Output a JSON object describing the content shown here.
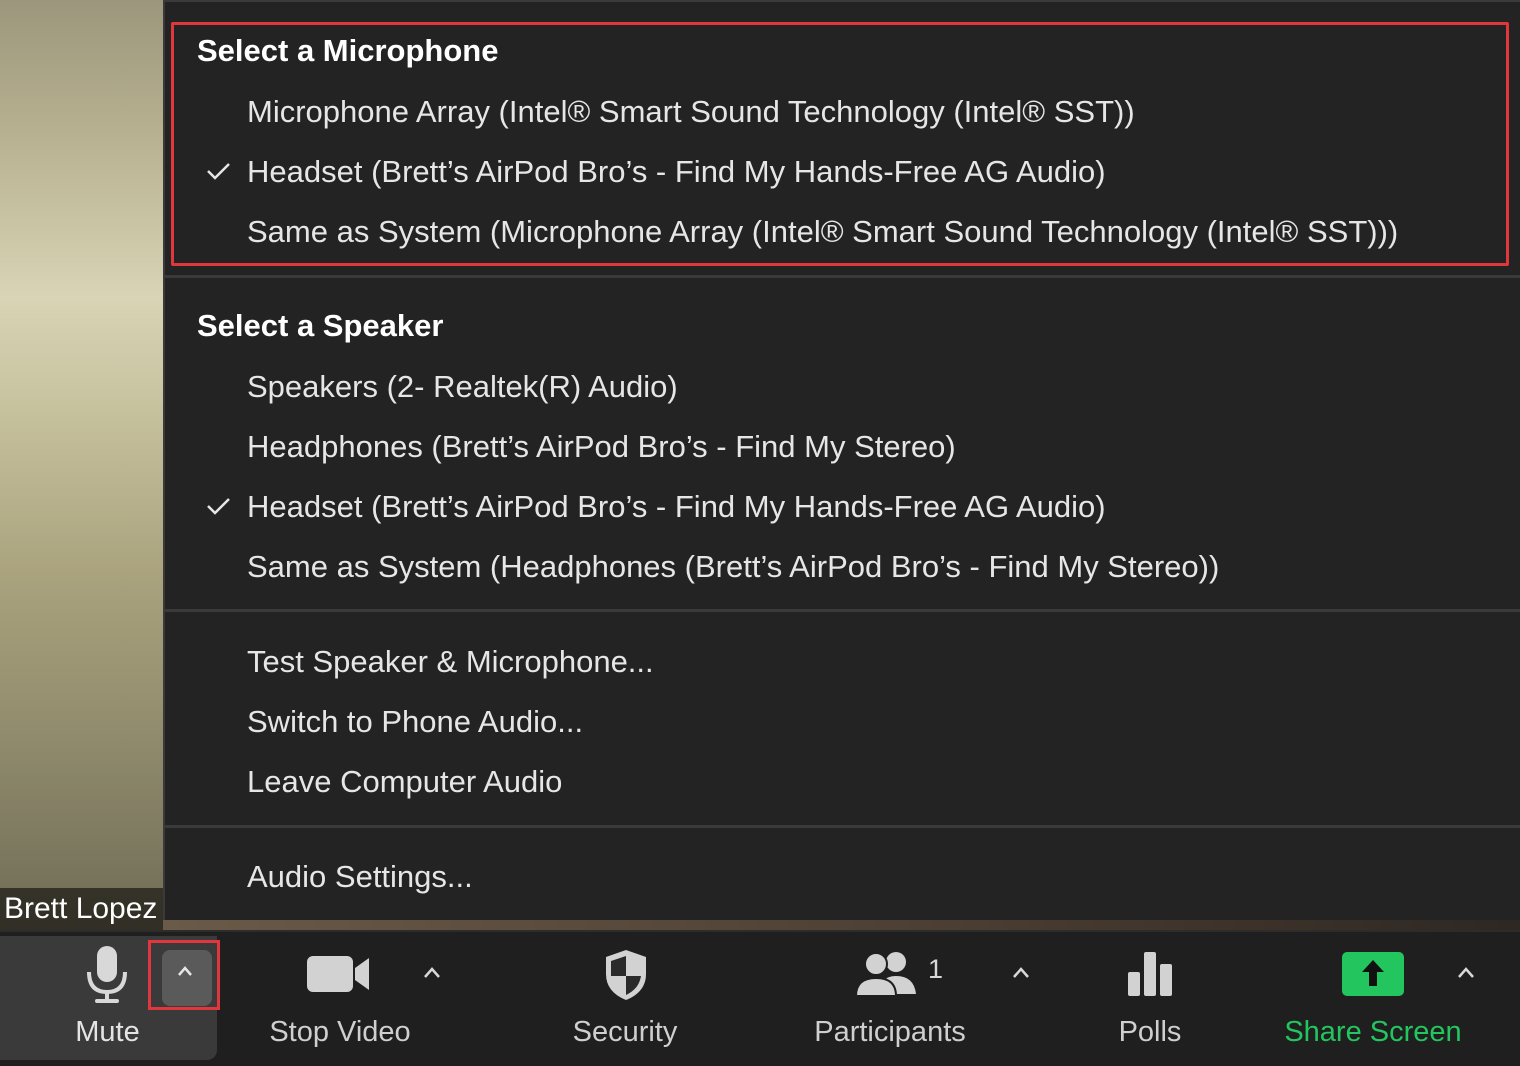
{
  "video": {
    "participant_name": "Brett Lopez"
  },
  "menu": {
    "microphone_section": {
      "title": "Select a Microphone",
      "items": [
        {
          "label": "Microphone Array (Intel® Smart Sound Technology (Intel® SST))",
          "checked": false
        },
        {
          "label": "Headset (Brett’s AirPod Bro’s - Find My Hands-Free AG Audio)",
          "checked": true
        },
        {
          "label": "Same as System (Microphone Array (Intel® Smart Sound Technology (Intel® SST)))",
          "checked": false
        }
      ]
    },
    "speaker_section": {
      "title": "Select a Speaker",
      "items": [
        {
          "label": "Speakers (2- Realtek(R) Audio)",
          "checked": false
        },
        {
          "label": "Headphones (Brett’s AirPod Bro’s - Find My Stereo)",
          "checked": false
        },
        {
          "label": "Headset (Brett’s AirPod Bro’s - Find My Hands-Free AG Audio)",
          "checked": true
        },
        {
          "label": "Same as System (Headphones (Brett’s AirPod Bro’s - Find My Stereo))",
          "checked": false
        }
      ]
    },
    "actions": {
      "test": "Test Speaker & Microphone...",
      "switch_phone": "Switch to Phone Audio...",
      "leave": "Leave Computer Audio"
    },
    "settings": "Audio Settings..."
  },
  "toolbar": {
    "mute": "Mute",
    "stop_video": "Stop Video",
    "security": "Security",
    "participants": "Participants",
    "participants_count": "1",
    "polls": "Polls",
    "share_screen": "Share Screen"
  },
  "colors": {
    "menu_bg": "#232323",
    "highlight": "#e0373f",
    "share_green": "#22c55e",
    "toolbar_bg": "#1f1f1f"
  }
}
